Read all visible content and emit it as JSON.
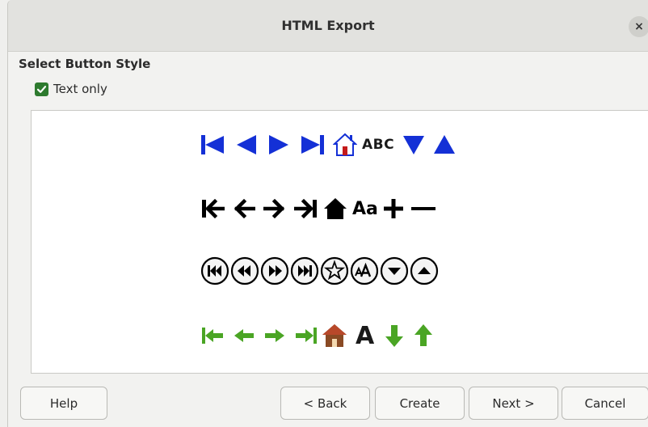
{
  "dialog": {
    "title": "HTML Export",
    "close_label": "×"
  },
  "section": {
    "title": "Select Button Style"
  },
  "text_only": {
    "label": "Text only",
    "checked": true
  },
  "style_rows": [
    {
      "name": "blue-triangles",
      "text_label": "ABC"
    },
    {
      "name": "black-arrows",
      "text_label": "Aa"
    },
    {
      "name": "round-buttons"
    },
    {
      "name": "green-arrows",
      "text_label": "A"
    }
  ],
  "footer": {
    "help": "Help",
    "back": "< Back",
    "create": "Create",
    "next": "Next >",
    "cancel": "Cancel"
  },
  "colors": {
    "blue": "#1430d6",
    "black": "#000000",
    "green": "#4aa524",
    "checkbox": "#2d7a2e"
  }
}
